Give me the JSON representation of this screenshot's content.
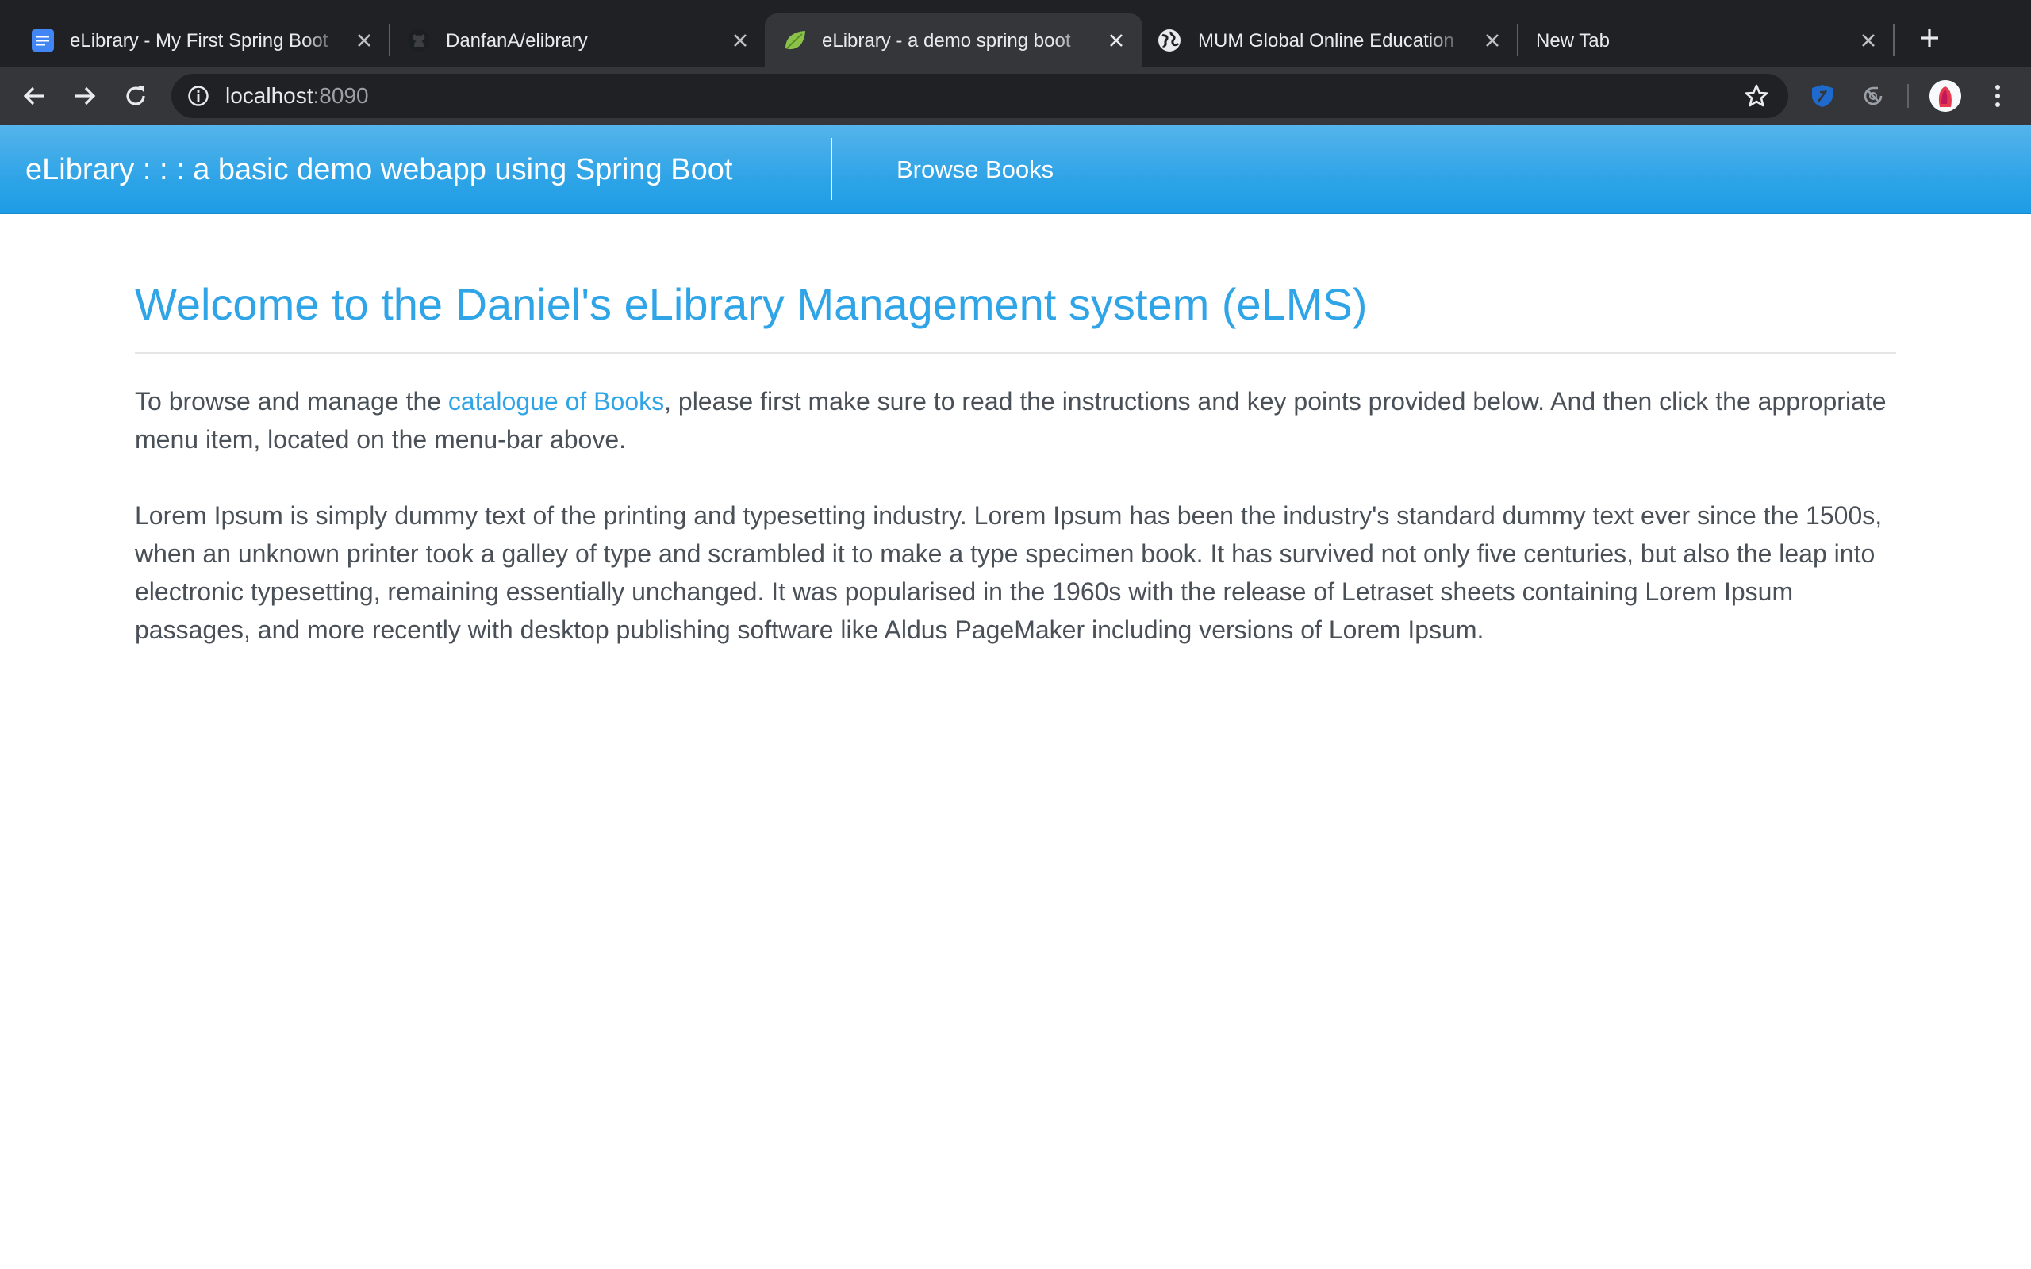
{
  "browser": {
    "tabs": [
      {
        "title": "eLibrary - My First Spring Boot",
        "favicon": "google-docs-icon",
        "active": false
      },
      {
        "title": "DanfanA/elibrary",
        "favicon": "github-icon",
        "active": false
      },
      {
        "title": "eLibrary - a demo spring boot",
        "favicon": "spring-leaf-icon",
        "active": true
      },
      {
        "title": "MUM Global Online Education",
        "favicon": "globe-icon",
        "active": false
      },
      {
        "title": "New Tab",
        "favicon": "",
        "active": false
      }
    ],
    "url_host": "localhost",
    "url_port": ":8090",
    "colors": {
      "tabstrip": "#202124",
      "toolbar": "#35363a",
      "omnibox": "#202124",
      "text": "#e8eaed"
    }
  },
  "site": {
    "brand": "eLibrary : : : a basic demo webapp using Spring Boot",
    "nav_browse": "Browse Books",
    "colors": {
      "primary": "#2fa4e7",
      "body_text": "#495057"
    }
  },
  "content": {
    "title": "Welcome to the Daniel's eLibrary Management system (eLMS)",
    "intro_before": "To browse and manage the ",
    "intro_link": "catalogue of Books",
    "intro_after": ", please first make sure to read the instructions and key points provided below. And then click the appropriate menu item, located on the menu-bar above.",
    "lorem": "Lorem Ipsum is simply dummy text of the printing and typesetting industry. Lorem Ipsum has been the industry's standard dummy text ever since the 1500s, when an unknown printer took a galley of type and scrambled it to make a type specimen book. It has survived not only five centuries, but also the leap into electronic typesetting, remaining essentially unchanged. It was popularised in the 1960s with the release of Letraset sheets containing Lorem Ipsum passages, and more recently with desktop publishing software like Aldus PageMaker including versions of Lorem Ipsum."
  }
}
